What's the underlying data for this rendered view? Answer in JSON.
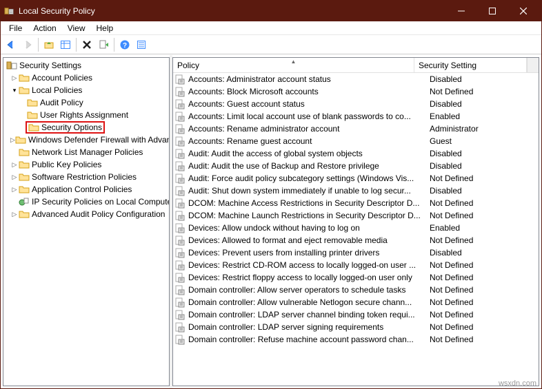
{
  "window": {
    "title": "Local Security Policy"
  },
  "menubar": [
    "File",
    "Action",
    "View",
    "Help"
  ],
  "tree": {
    "root": "Security Settings",
    "account_policies": "Account Policies",
    "local_policies": "Local Policies",
    "audit_policy": "Audit Policy",
    "user_rights": "User Rights Assignment",
    "security_options": "Security Options",
    "firewall": "Windows Defender Firewall with Advanced Security",
    "network_list": "Network List Manager Policies",
    "public_key": "Public Key Policies",
    "software_restriction": "Software Restriction Policies",
    "app_control": "Application Control Policies",
    "ip_security": "IP Security Policies on Local Computer",
    "advanced_audit": "Advanced Audit Policy Configuration"
  },
  "columns": {
    "policy": "Policy",
    "setting": "Security Setting"
  },
  "policies": [
    {
      "name": "Accounts: Administrator account status",
      "setting": "Disabled"
    },
    {
      "name": "Accounts: Block Microsoft accounts",
      "setting": "Not Defined"
    },
    {
      "name": "Accounts: Guest account status",
      "setting": "Disabled"
    },
    {
      "name": "Accounts: Limit local account use of blank passwords to co...",
      "setting": "Enabled"
    },
    {
      "name": "Accounts: Rename administrator account",
      "setting": "Administrator"
    },
    {
      "name": "Accounts: Rename guest account",
      "setting": "Guest"
    },
    {
      "name": "Audit: Audit the access of global system objects",
      "setting": "Disabled"
    },
    {
      "name": "Audit: Audit the use of Backup and Restore privilege",
      "setting": "Disabled"
    },
    {
      "name": "Audit: Force audit policy subcategory settings (Windows Vis...",
      "setting": "Not Defined"
    },
    {
      "name": "Audit: Shut down system immediately if unable to log secur...",
      "setting": "Disabled"
    },
    {
      "name": "DCOM: Machine Access Restrictions in Security Descriptor D...",
      "setting": "Not Defined"
    },
    {
      "name": "DCOM: Machine Launch Restrictions in Security Descriptor D...",
      "setting": "Not Defined"
    },
    {
      "name": "Devices: Allow undock without having to log on",
      "setting": "Enabled"
    },
    {
      "name": "Devices: Allowed to format and eject removable media",
      "setting": "Not Defined"
    },
    {
      "name": "Devices: Prevent users from installing printer drivers",
      "setting": "Disabled"
    },
    {
      "name": "Devices: Restrict CD-ROM access to locally logged-on user ...",
      "setting": "Not Defined"
    },
    {
      "name": "Devices: Restrict floppy access to locally logged-on user only",
      "setting": "Not Defined"
    },
    {
      "name": "Domain controller: Allow server operators to schedule tasks",
      "setting": "Not Defined"
    },
    {
      "name": "Domain controller: Allow vulnerable Netlogon secure chann...",
      "setting": "Not Defined"
    },
    {
      "name": "Domain controller: LDAP server channel binding token requi...",
      "setting": "Not Defined"
    },
    {
      "name": "Domain controller: LDAP server signing requirements",
      "setting": "Not Defined"
    },
    {
      "name": "Domain controller: Refuse machine account password chan...",
      "setting": "Not Defined"
    }
  ],
  "watermark": "wsxdn.com"
}
